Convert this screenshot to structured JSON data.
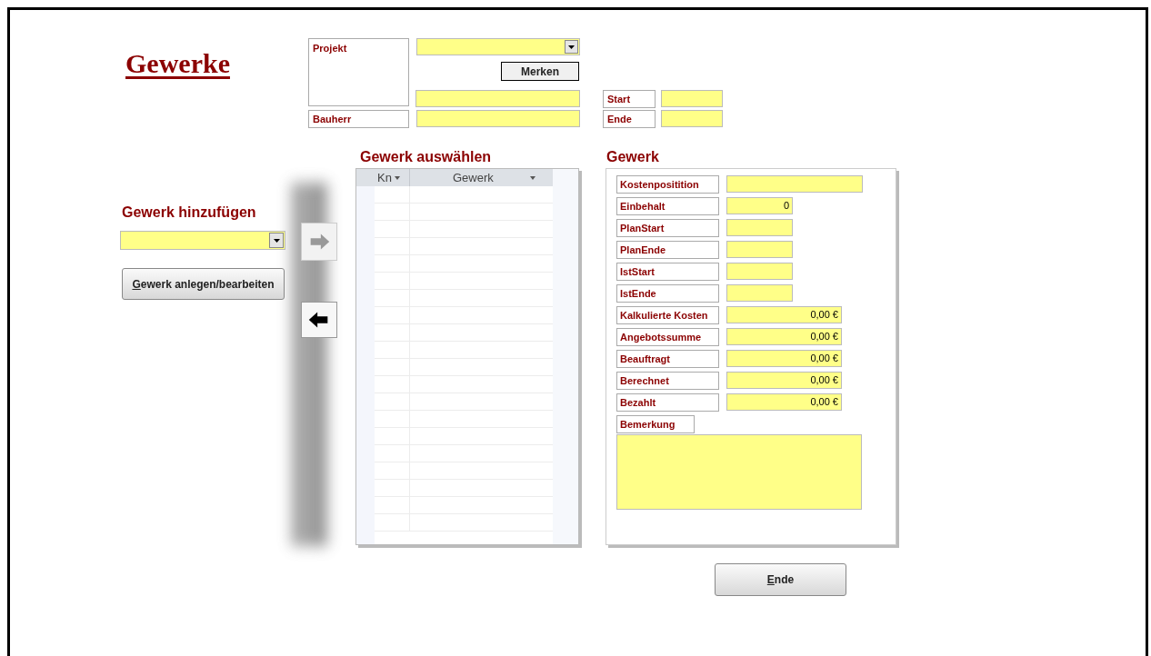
{
  "title": "Gewerke",
  "project": {
    "label": "Projekt",
    "merken_button": "Merken",
    "bauherr_label": "Bauherr",
    "start_label": "Start",
    "ende_label": "Ende"
  },
  "add_section": {
    "heading": "Gewerk hinzufügen",
    "button": "Gewerk anlegen/bearbeiten"
  },
  "arrow_buttons": [
    {
      "kind": "right",
      "disabled": true
    },
    {
      "kind": "left",
      "disabled": false
    }
  ],
  "list": {
    "heading": "Gewerk auswählen",
    "columns": [
      "Kn",
      "Gewerk"
    ]
  },
  "details": {
    "heading": "Gewerk",
    "fields": [
      {
        "label": "Kostenpositition",
        "kind": "wide"
      },
      {
        "label": "Einbehalt",
        "kind": "short",
        "value": "0"
      },
      {
        "label": "PlanStart",
        "kind": "short"
      },
      {
        "label": "PlanEnde",
        "kind": "short"
      },
      {
        "label": "IstStart",
        "kind": "short"
      },
      {
        "label": "IstEnde",
        "kind": "short"
      },
      {
        "label": "Kalkulierte Kosten",
        "kind": "money",
        "value": "0,00 €"
      },
      {
        "label": "Angebotssumme",
        "kind": "money",
        "value": "0,00 €"
      },
      {
        "label": "Beauftragt",
        "kind": "money",
        "value": "0,00 €"
      },
      {
        "label": "Berechnet",
        "kind": "money",
        "value": "0,00 €"
      },
      {
        "label": "Bezahlt",
        "kind": "money",
        "value": "0,00 €"
      }
    ],
    "remark_label": "Bemerkung"
  },
  "ende_button": "Ende"
}
